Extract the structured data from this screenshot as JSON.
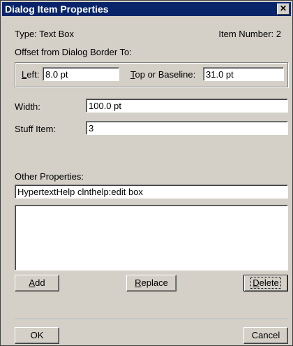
{
  "window": {
    "title": "Dialog Item Properties",
    "close_glyph": "✕"
  },
  "info": {
    "type_label": "Type: Text Box",
    "item_number": "Item Number: 2",
    "offset_heading": "Offset from Dialog Border To:"
  },
  "offset": {
    "left_label_accel": "L",
    "left_label_rest": "eft:",
    "left_value": "8.0 pt",
    "top_label_accel": "T",
    "top_label_rest": "op or Baseline:",
    "top_value": "31.0 pt"
  },
  "width": {
    "label": "Width:",
    "value": "100.0 pt"
  },
  "stuff": {
    "label": "Stuff Item:",
    "value": "3"
  },
  "other": {
    "label": "Other Properties:",
    "value": "HypertextHelp clnthelp:edit box"
  },
  "buttons": {
    "add_accel": "A",
    "add_rest": "dd",
    "replace_accel": "R",
    "replace_rest": "eplace",
    "delete_accel": "D",
    "delete_rest": "elete",
    "ok": "OK",
    "cancel": "Cancel"
  }
}
